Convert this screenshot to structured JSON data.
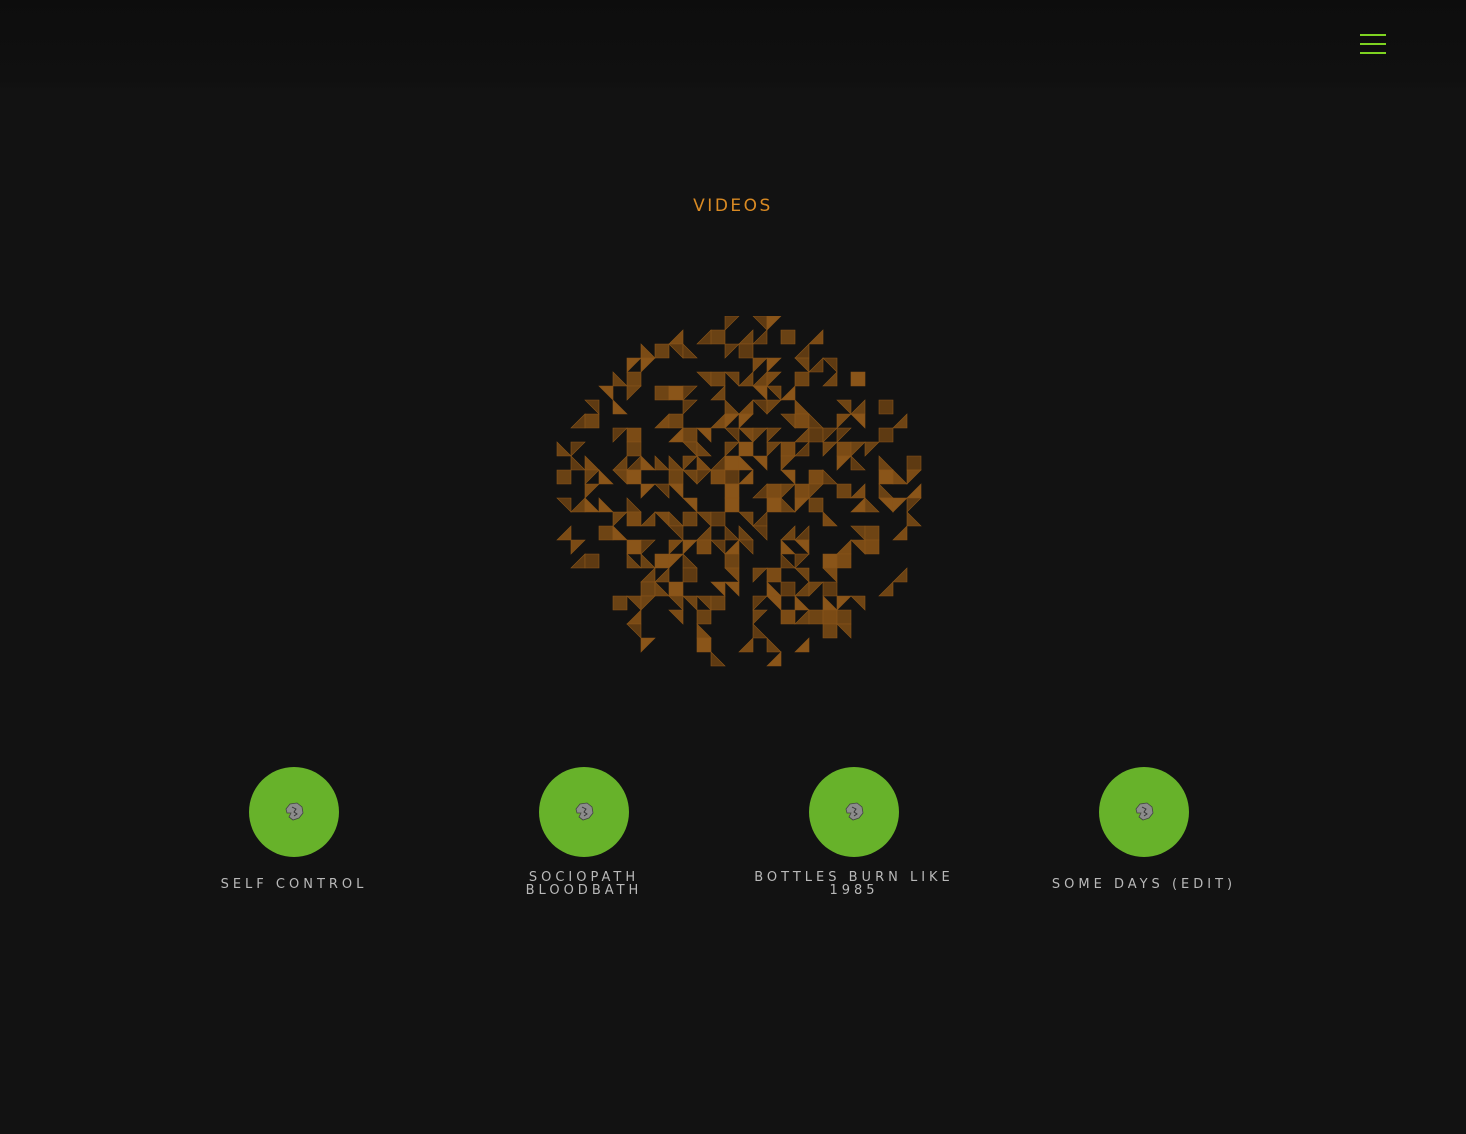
{
  "header": {
    "menu_icon": "hamburger-menu-icon",
    "menu_color": "#7ed321"
  },
  "page": {
    "title": "VIDEOS",
    "title_color": "#d98a23",
    "background": "#121212"
  },
  "logo": {
    "icon": "mosaic-globe-logo",
    "color": "#7a4a14"
  },
  "videos": [
    {
      "label": "SELF CONTROL",
      "thumb_icon": "band-logo-icon",
      "thumb_color": "#67b22a"
    },
    {
      "label": "SOCIOPATH BLOODBATH",
      "thumb_icon": "band-logo-icon",
      "thumb_color": "#67b22a"
    },
    {
      "label": "BOTTLES BURN LIKE 1985",
      "thumb_icon": "band-logo-icon",
      "thumb_color": "#67b22a"
    },
    {
      "label": "SOME DAYS (EDIT)",
      "thumb_icon": "band-logo-icon",
      "thumb_color": "#67b22a"
    }
  ]
}
